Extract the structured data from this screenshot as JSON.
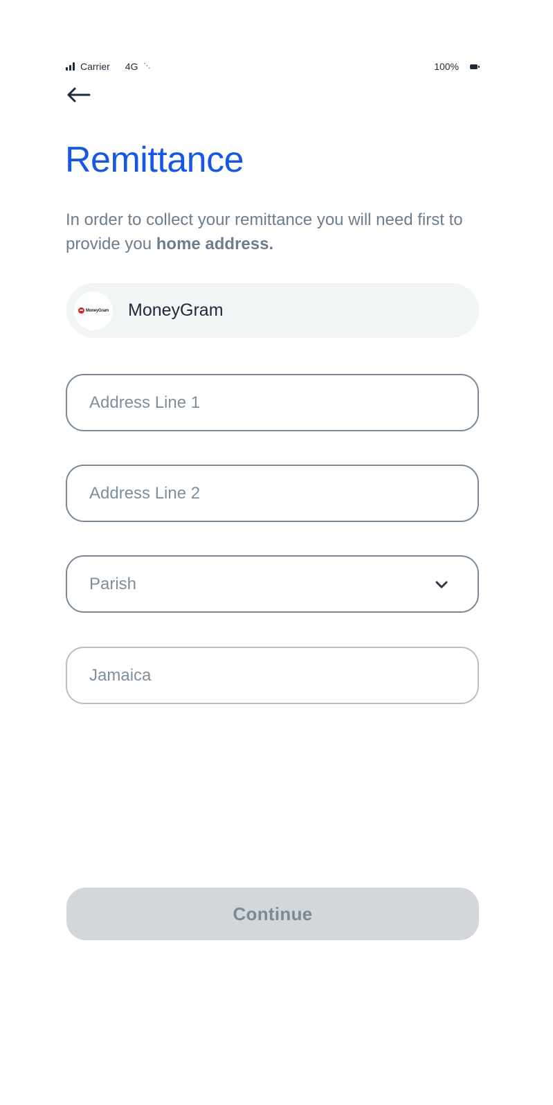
{
  "status_bar": {
    "carrier": "Carrier",
    "network": "4G",
    "battery": "100%"
  },
  "header": {
    "title": "Remittance"
  },
  "description": {
    "text": "In order to collect your remittance you will need first to provide you ",
    "emphasis": "home address."
  },
  "provider": {
    "name": "MoneyGram",
    "logo_text": "MoneyGram"
  },
  "form": {
    "address_line_1": {
      "placeholder": "Address Line 1",
      "value": ""
    },
    "address_line_2": {
      "placeholder": "Address Line 2",
      "value": ""
    },
    "parish": {
      "placeholder": "Parish"
    },
    "country": {
      "value": "Jamaica"
    }
  },
  "actions": {
    "continue_label": "Continue"
  },
  "colors": {
    "title": "#1657e3",
    "description": "#6d7d8b",
    "field_border": "#7a8896",
    "button_disabled_bg": "#d3d7db",
    "button_disabled_text": "#7c8994",
    "brand_red": "#d9262e"
  }
}
